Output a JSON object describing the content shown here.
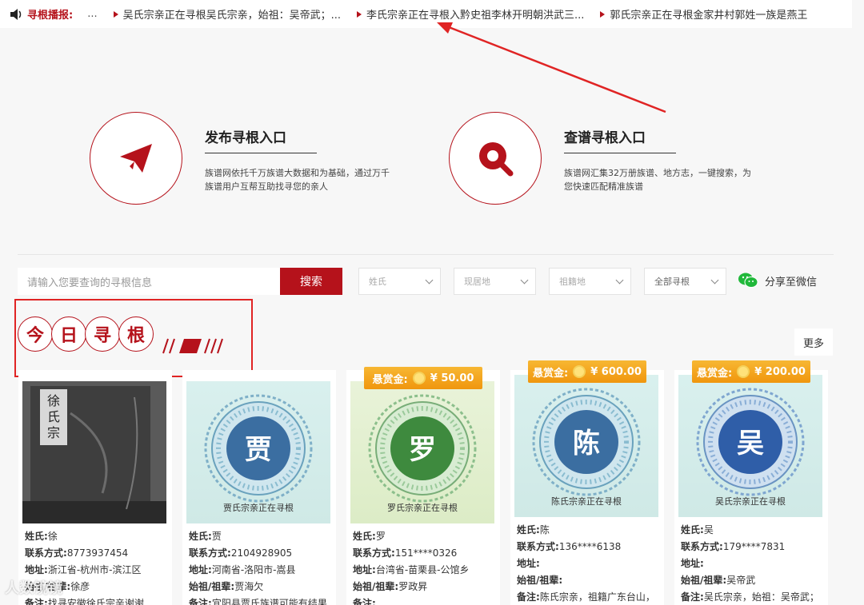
{
  "ticker": {
    "label": "寻根播报:",
    "dots": "...",
    "items": [
      "吴氏宗亲正在寻根吴氏宗亲，始祖：吴帝武；...",
      "李氏宗亲正在寻根入黔史祖李林开明朝洪武三...",
      "郭氏宗亲正在寻根金家井村郭姓一族是燕王"
    ]
  },
  "entries": [
    {
      "title": "发布寻根入口",
      "desc": "族谱网依托千万族谱大数据和为基础，通过万千族谱用户互帮互助找寻您的亲人",
      "icon": "paper-plane-icon"
    },
    {
      "title": "查谱寻根入口",
      "desc": "族谱网汇集32万册族谱、地方志，一键搜索，为您快速匹配精准族谱",
      "icon": "search-icon"
    }
  ],
  "search": {
    "placeholder": "请输入您要查询的寻根信息",
    "button": "搜索",
    "filters": [
      "姓氏",
      "现居地",
      "祖籍地",
      "全部寻根"
    ],
    "share": "分享至微信"
  },
  "today": {
    "chars": [
      "今",
      "日",
      "寻",
      "根"
    ],
    "more": "更多"
  },
  "labels": {
    "surname": "姓氏:",
    "contact": "联系方式:",
    "address": "地址:",
    "ancestor": "始祖/祖辈:",
    "note": "备注:"
  },
  "colors": {
    "brand": "#b5121b",
    "bounty": "#f0960e",
    "annotation": "#e02424"
  },
  "cards": [
    {
      "type": "photo",
      "surname": "徐",
      "caption": "",
      "contact": "8773937454",
      "address": "浙江省-杭州市-滨江区",
      "ancestor": "徐彦",
      "note": "找寻安徽徐氏宗亲谢谢"
    },
    {
      "type": "medal",
      "char": "贾",
      "medal_color": "#3b6ea1",
      "caption": "贾氏宗亲正在寻根",
      "surname": "贾",
      "contact": "2104928905",
      "address": "河南省-洛阳市-嵩县",
      "ancestor": "贾海欠",
      "note": "宜阳县贾氏族谱可能有结果"
    },
    {
      "type": "medal",
      "char": "罗",
      "medal_color": "#3e8a3e",
      "caption": "罗氏宗亲正在寻根",
      "bounty": "¥ 50.00",
      "bounty_label": "悬赏金:",
      "surname": "罗",
      "contact": "151****0326",
      "address": "台湾省-苗栗县-公馆乡",
      "ancestor": "罗政昇",
      "note": ""
    },
    {
      "type": "medal",
      "char": "陈",
      "medal_color": "#3b6ea1",
      "caption": "陈氏宗亲正在寻根",
      "bounty": "¥ 600.00",
      "bounty_label": "悬赏金:",
      "surname": "陈",
      "contact": "136****6138",
      "address": "",
      "ancestor": "",
      "note": "陈氏宗亲，祖籍广东台山，"
    },
    {
      "type": "medal",
      "char": "吴",
      "medal_color": "#2f5ea8",
      "caption": "吴氏宗亲正在寻根",
      "bounty": "¥ 200.00",
      "bounty_label": "悬赏金:",
      "surname": "吴",
      "contact": "179****7831",
      "address": "",
      "ancestor": "吴帝武",
      "note": "吴氏宗亲，始祖：吴帝武；"
    }
  ],
  "watermark": "人数镜镜"
}
